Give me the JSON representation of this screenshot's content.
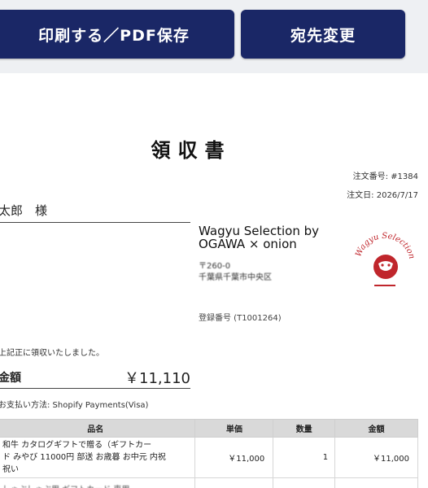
{
  "toolbar": {
    "print_label": "印刷する／PDF保存",
    "address_label": "宛先変更"
  },
  "receipt": {
    "title": "領収書",
    "order_number": "注文番号: #1384",
    "order_date": "注文日: 2026/7/17",
    "recipient": "太郎　様",
    "store_name_line1": "Wagyu Selection by",
    "store_name_line2": "OGAWA × onion",
    "store_address_line1": "〒260-0",
    "store_address_line2": "千葉県千葉市中央区",
    "store_registration": "登録番号 (T1001264)",
    "logo_text": "Wagyu Selection",
    "received_text": "上記正に領収いたしました。",
    "amount_label": "金額",
    "amount_value": "￥11,110",
    "payment_method": "お支払い方法: Shopify Payments(Visa)"
  },
  "table": {
    "headers": {
      "item": "品名",
      "unit_price": "単価",
      "qty": "数量",
      "amount": "金額"
    },
    "rows": [
      {
        "item_line1": "和牛 カタログギフトで贈る（ギフトカー",
        "item_line2": "ド みやび 11000円 部送 お歳暮 お中元 内祝",
        "item_line3": "祝い",
        "unit_price": "￥11,000",
        "qty": "1",
        "amount": "￥11,000"
      }
    ],
    "partial_row_text": "しゃぶしゃぶ用 ギフトカード 専用"
  },
  "colors": {
    "button_bg": "#1a2766",
    "logo_red": "#c0262c"
  }
}
